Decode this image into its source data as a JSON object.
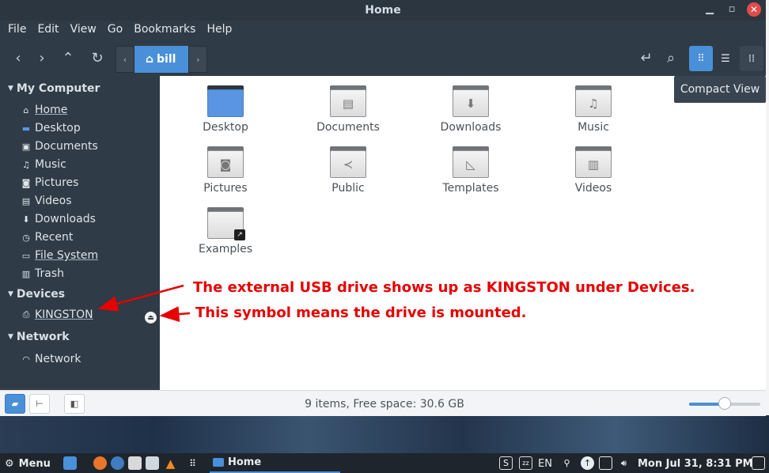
{
  "window": {
    "title": "Home"
  },
  "menu": [
    "File",
    "Edit",
    "View",
    "Go",
    "Bookmarks",
    "Help"
  ],
  "pathbar": {
    "current": "bill"
  },
  "tooltip": "Compact View",
  "sidebar": {
    "my_computer": {
      "title": "My Computer",
      "items": [
        {
          "label": "Home",
          "icon": "home-icon"
        },
        {
          "label": "Desktop",
          "icon": "desktop-icon"
        },
        {
          "label": "Documents",
          "icon": "documents-icon"
        },
        {
          "label": "Music",
          "icon": "music-icon"
        },
        {
          "label": "Pictures",
          "icon": "pictures-icon"
        },
        {
          "label": "Videos",
          "icon": "videos-icon"
        },
        {
          "label": "Downloads",
          "icon": "downloads-icon"
        },
        {
          "label": "Recent",
          "icon": "recent-icon"
        },
        {
          "label": "File System",
          "icon": "filesystem-icon"
        },
        {
          "label": "Trash",
          "icon": "trash-icon"
        }
      ]
    },
    "devices": {
      "title": "Devices",
      "items": [
        {
          "label": "KINGSTON",
          "icon": "usb-drive-icon"
        }
      ]
    },
    "network": {
      "title": "Network",
      "items": [
        {
          "label": "Network",
          "icon": "network-icon"
        }
      ]
    }
  },
  "files": [
    {
      "label": "Desktop",
      "icon": "desktop-folder-icon"
    },
    {
      "label": "Documents",
      "icon": "document-icon"
    },
    {
      "label": "Downloads",
      "icon": "download-icon"
    },
    {
      "label": "Music",
      "icon": "music-note-icon"
    },
    {
      "label": "Pictures",
      "icon": "camera-icon"
    },
    {
      "label": "Public",
      "icon": "share-icon"
    },
    {
      "label": "Templates",
      "icon": "template-icon"
    },
    {
      "label": "Videos",
      "icon": "film-icon"
    },
    {
      "label": "Examples",
      "icon": "symlink-icon"
    }
  ],
  "annotations": {
    "line1": "The external USB drive shows up as KINGSTON under Devices.",
    "line2": "This symbol means the drive is mounted."
  },
  "status": {
    "text": "9 items, Free space: 30.6 GB",
    "zoom_fraction": 0.5
  },
  "taskbar": {
    "menu_label": "Menu",
    "window_label": "Home",
    "lang": "EN",
    "clock": "Mon Jul 31,  8:31 PM"
  },
  "colors": {
    "accent": "#4a90d9",
    "sidebar": "#2f3b46",
    "annotation": "#e60000"
  }
}
